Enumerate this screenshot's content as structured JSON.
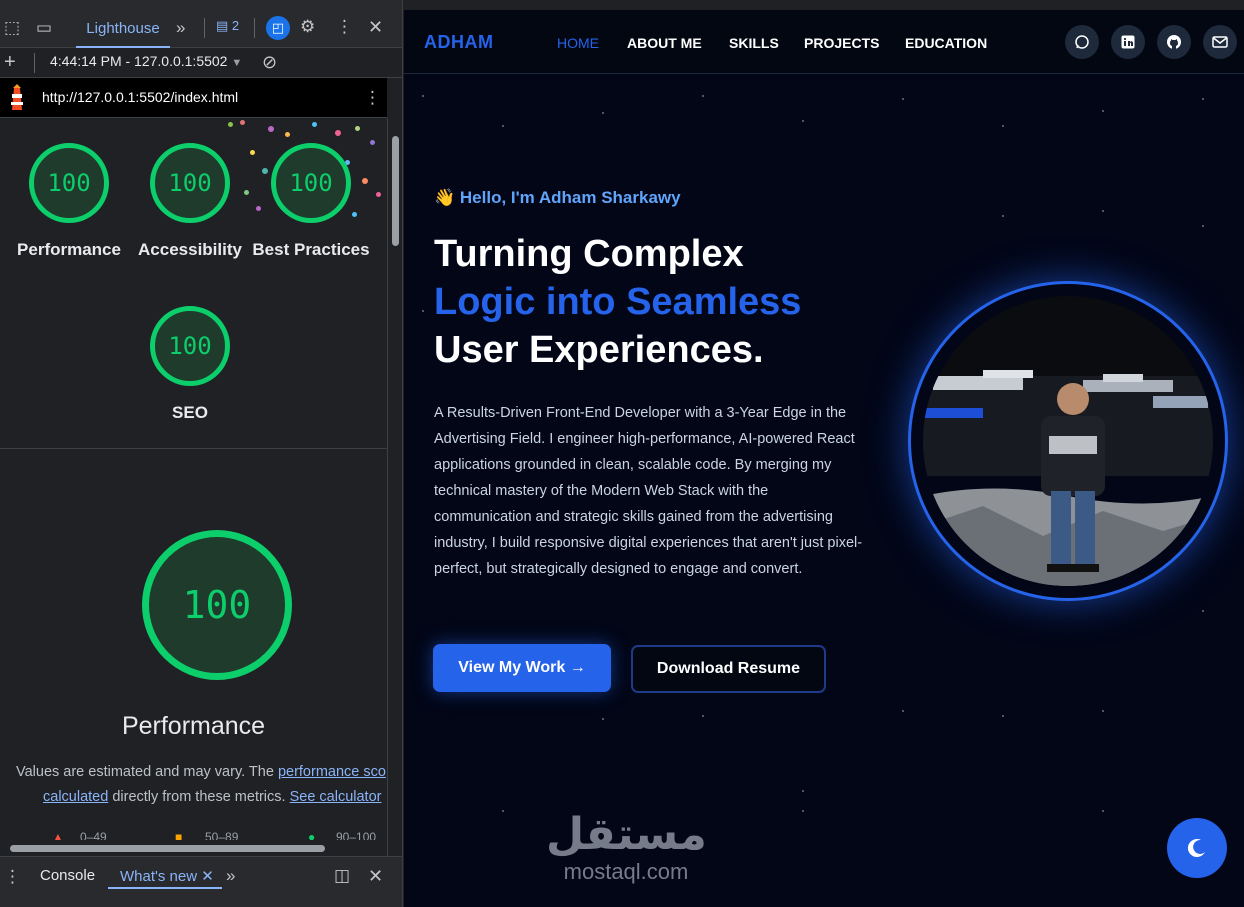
{
  "devtools": {
    "active_tab": "Lighthouse",
    "issues_count": "2",
    "report_time": "4:44:14 PM - 127.0.0.1:5502",
    "url": "http://127.0.0.1:5502/index.html",
    "scores": [
      {
        "label": "Performance",
        "value": "100"
      },
      {
        "label": "Accessibility",
        "value": "100"
      },
      {
        "label": "Best Practices",
        "value": "100"
      },
      {
        "label": "SEO",
        "value": "100"
      }
    ],
    "main_score": "100",
    "main_title": "Performance",
    "desc_line1_pre": "Values are estimated and may vary. The ",
    "desc_link1": "performance sco",
    "desc_link2": "calculated",
    "desc_line2_mid": " directly from these metrics. ",
    "desc_link3": "See calculator",
    "legend": [
      "0–49",
      "50–89",
      "90–100"
    ],
    "drawer_tabs": [
      "Console",
      "What's new"
    ],
    "colors": {
      "pass": "#0cce6b",
      "link": "#8ab4f8"
    }
  },
  "site": {
    "logo": "ADHAM",
    "nav": [
      "HOME",
      "ABOUT ME",
      "SKILLS",
      "PROJECTS",
      "EDUCATION"
    ],
    "social_icons": [
      "whatsapp-icon",
      "linkedin-icon",
      "github-icon",
      "mail-icon"
    ],
    "hello": "👋 Hello, I'm Adham Sharkawy",
    "headline_1": "Turning Complex",
    "headline_2": "Logic into Seamless",
    "headline_3": "User Experiences.",
    "description": "A Results-Driven Front-End Developer with a 3-Year Edge in the Advertising Field. I engineer high-performance, AI-powered React applications grounded in clean, scalable code. By merging my technical mastery of the Modern Web Stack with the communication and strategic skills gained from the advertising industry, I build responsive digital experiences that aren't just pixel-perfect, but strategically designed to engage and convert.",
    "btn_work": "View My Work →",
    "btn_resume": "Download Resume",
    "watermark_ar": "مستقل",
    "watermark_en": "mostaql.com",
    "colors": {
      "accent": "#2563eb",
      "bg": "#020617"
    }
  }
}
